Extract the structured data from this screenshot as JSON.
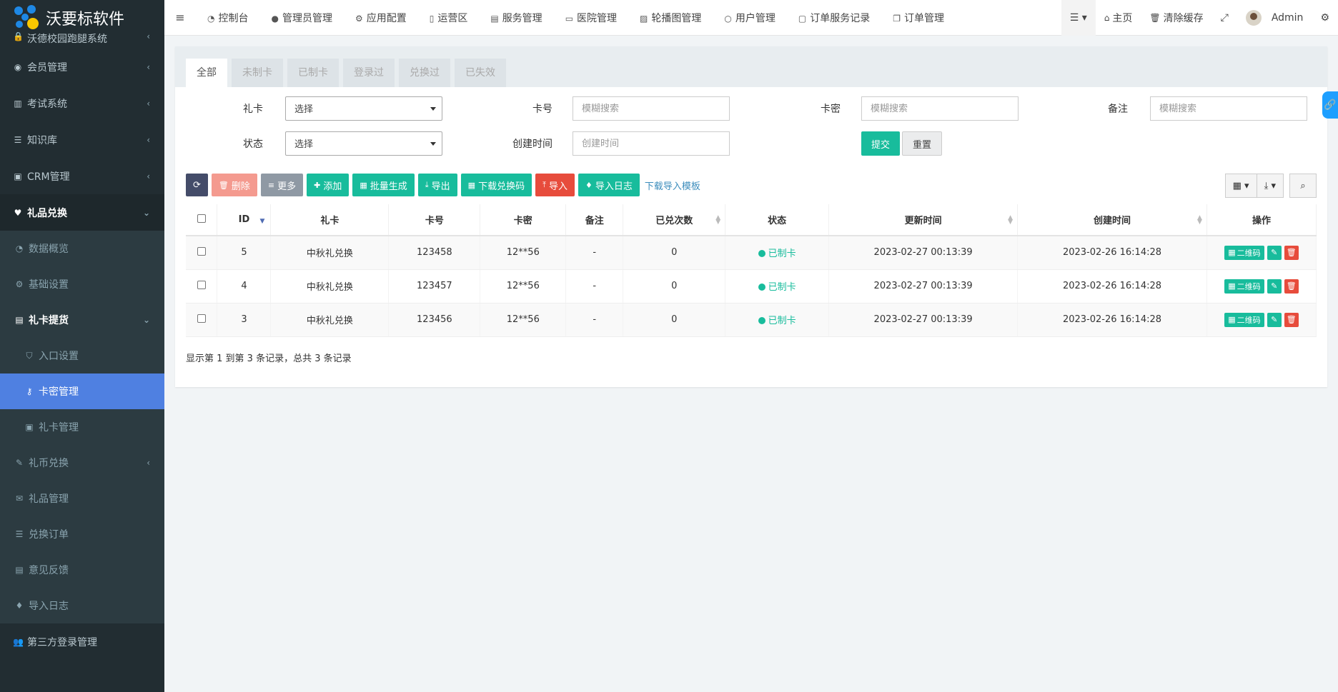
{
  "app": {
    "title": "沃要标软件"
  },
  "sidebar": {
    "items": [
      {
        "label": "沃德校园跑腿系统",
        "icon": "lock-icon"
      },
      {
        "label": "会员管理",
        "icon": "user-circle-icon"
      },
      {
        "label": "考试系统",
        "icon": "columns-icon"
      },
      {
        "label": "知识库",
        "icon": "list-icon"
      },
      {
        "label": "CRM管理",
        "icon": "id-card-icon"
      },
      {
        "label": "礼品兑换",
        "icon": "heart-icon"
      },
      {
        "label": "数据概览",
        "icon": "dashboard-icon"
      },
      {
        "label": "基础设置",
        "icon": "cogs-icon"
      },
      {
        "label": "礼卡提货",
        "icon": "archive-icon"
      },
      {
        "label": "入口设置",
        "icon": "shield-icon"
      },
      {
        "label": "卡密管理",
        "icon": "key-icon"
      },
      {
        "label": "礼卡管理",
        "icon": "id-card-icon"
      },
      {
        "label": "礼币兑换",
        "icon": "gavel-icon"
      },
      {
        "label": "礼品管理",
        "icon": "gift-icon"
      },
      {
        "label": "兑换订单",
        "icon": "list-icon"
      },
      {
        "label": "意见反馈",
        "icon": "list-alt-icon"
      },
      {
        "label": "导入日志",
        "icon": "drop-icon"
      },
      {
        "label": "第三方登录管理",
        "icon": "users-icon"
      }
    ]
  },
  "topbar": {
    "links": [
      {
        "label": "控制台",
        "icon": "dashboard-icon"
      },
      {
        "label": "管理员管理",
        "icon": "user-icon"
      },
      {
        "label": "应用配置",
        "icon": "gear-icon"
      },
      {
        "label": "运营区",
        "icon": "map-icon"
      },
      {
        "label": "服务管理",
        "icon": "list-alt-icon"
      },
      {
        "label": "医院管理",
        "icon": "clipboard-icon"
      },
      {
        "label": "轮播图管理",
        "icon": "image-icon"
      },
      {
        "label": "用户管理",
        "icon": "user-outline-icon"
      },
      {
        "label": "订单服务记录",
        "icon": "save-icon"
      },
      {
        "label": "订单管理",
        "icon": "copy-icon"
      }
    ],
    "home": "主页",
    "clear_cache": "清除缓存",
    "user": "Admin"
  },
  "tabs": [
    "全部",
    "未制卡",
    "已制卡",
    "登录过",
    "兑换过",
    "已失效"
  ],
  "filter": {
    "gift_card_label": "礼卡",
    "gift_card_value": "选择",
    "card_no_label": "卡号",
    "card_no_placeholder": "模糊搜索",
    "card_pwd_label": "卡密",
    "card_pwd_placeholder": "模糊搜索",
    "remark_label": "备注",
    "remark_placeholder": "模糊搜索",
    "status_label": "状态",
    "status_value": "选择",
    "created_label": "创建时间",
    "created_placeholder": "创建时间",
    "submit": "提交",
    "reset": "重置"
  },
  "toolbar": {
    "delete": "删除",
    "more": "更多",
    "add": "添加",
    "batch_generate": "批量生成",
    "export": "导出",
    "download_codes": "下载兑换码",
    "import": "导入",
    "import_log": "导入日志",
    "download_template": "下载导入模板"
  },
  "table": {
    "headers": [
      "ID",
      "礼卡",
      "卡号",
      "卡密",
      "备注",
      "已兑次数",
      "状态",
      "更新时间",
      "创建时间",
      "操作"
    ],
    "rows": [
      {
        "id": "5",
        "gift_card": "中秋礼兑换",
        "card_no": "123458",
        "card_pwd": "12**56",
        "remark": "-",
        "redeemed": "0",
        "status": "已制卡",
        "updated": "2023-02-27 00:13:39",
        "created": "2023-02-26 16:14:28"
      },
      {
        "id": "4",
        "gift_card": "中秋礼兑换",
        "card_no": "123457",
        "card_pwd": "12**56",
        "remark": "-",
        "redeemed": "0",
        "status": "已制卡",
        "updated": "2023-02-27 00:13:39",
        "created": "2023-02-26 16:14:28"
      },
      {
        "id": "3",
        "gift_card": "中秋礼兑换",
        "card_no": "123456",
        "card_pwd": "12**56",
        "remark": "-",
        "redeemed": "0",
        "status": "已制卡",
        "updated": "2023-02-27 00:13:39",
        "created": "2023-02-26 16:14:28"
      }
    ],
    "op_qr": "二维码"
  },
  "pagination": {
    "summary": "显示第 1 到第 3 条记录，总共 3 条记录"
  },
  "colors": {
    "sidebar_bg": "#222d32",
    "active": "#4f80e1",
    "primary": "#18bc9c",
    "danger": "#e74c3c"
  }
}
